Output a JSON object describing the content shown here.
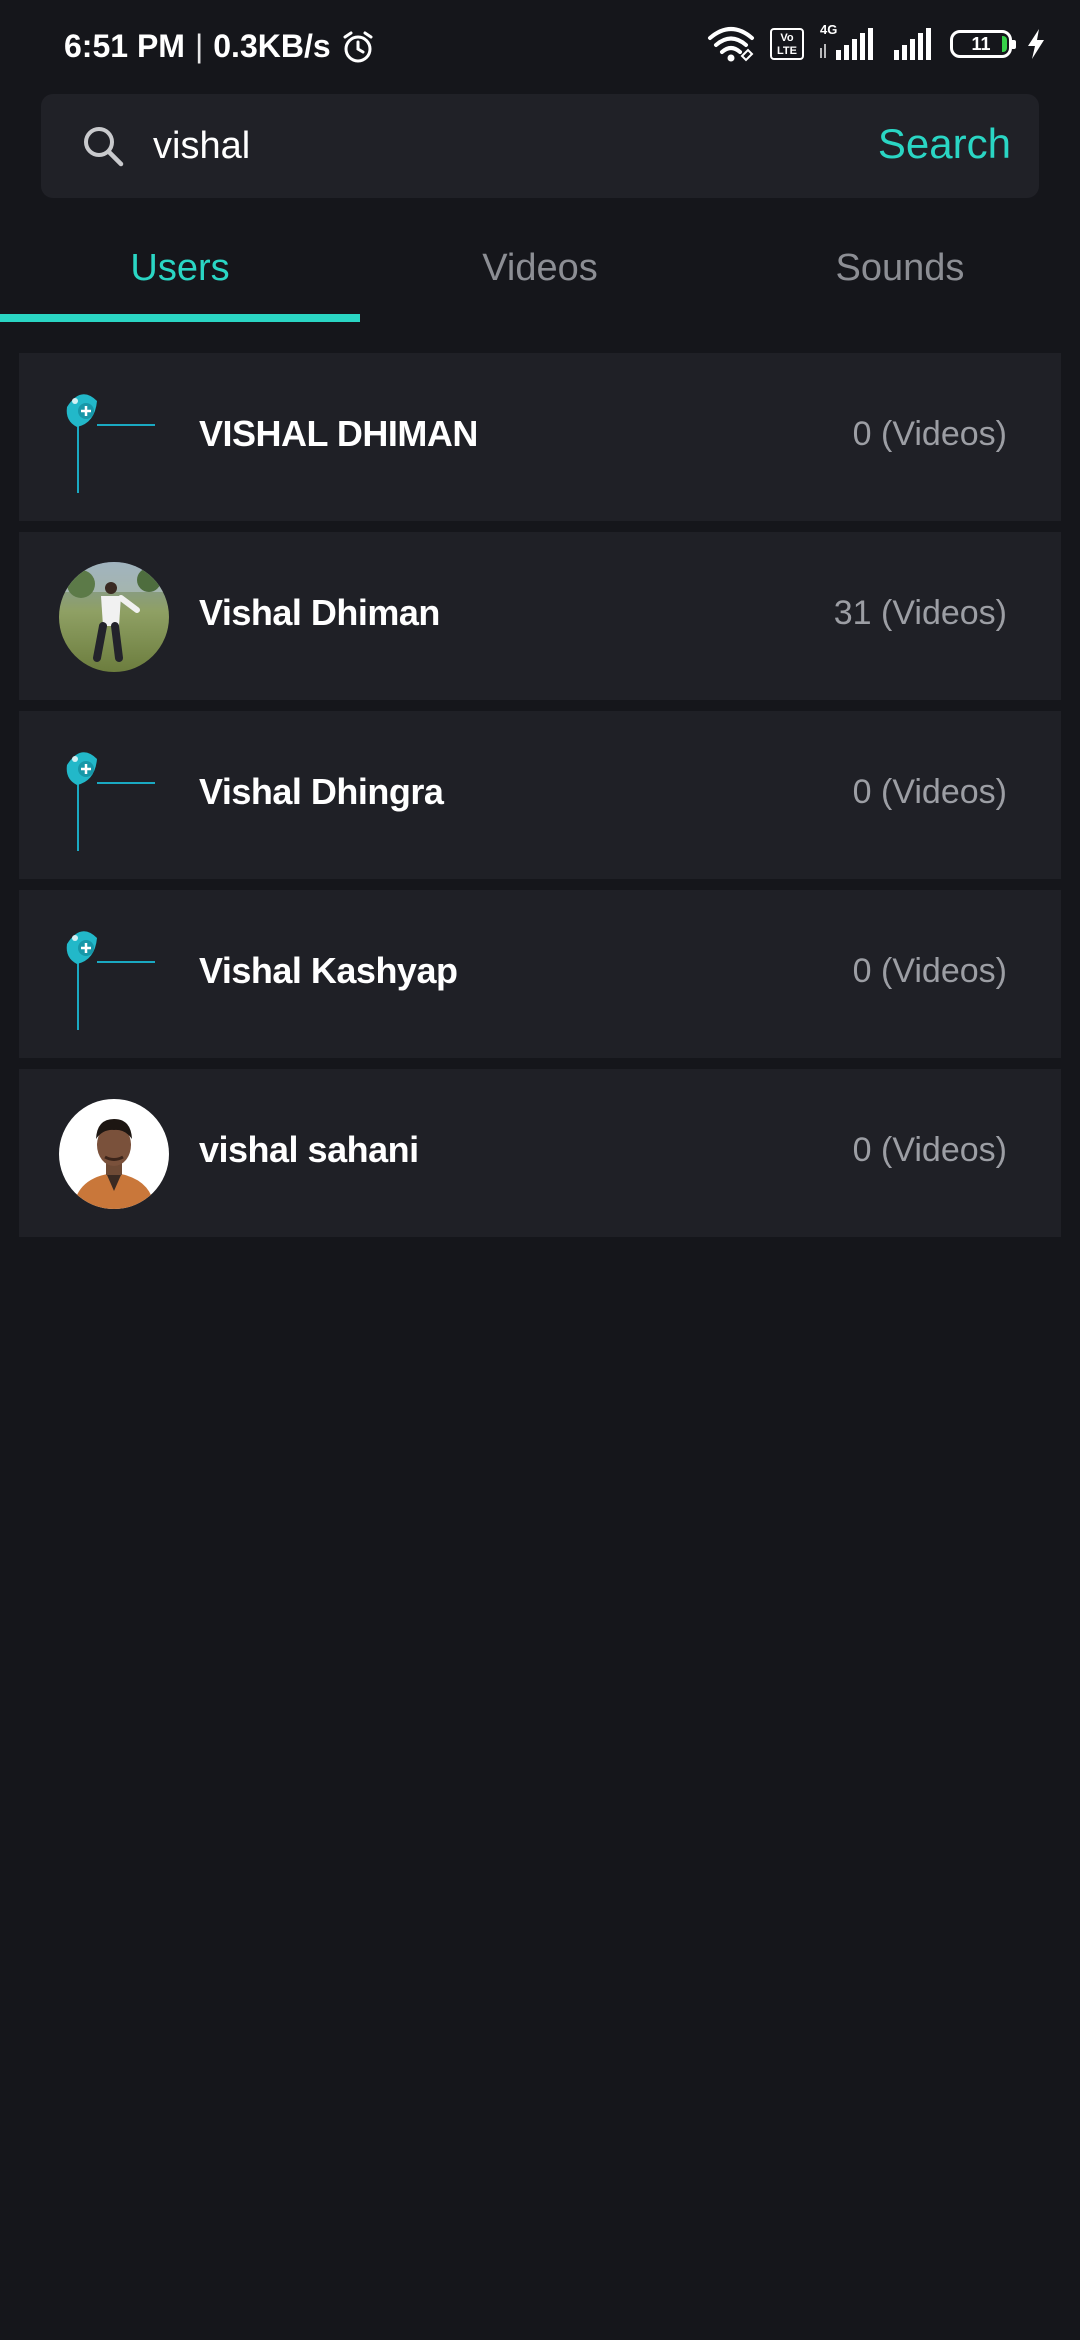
{
  "status_bar": {
    "time": "6:51 PM",
    "separator": "|",
    "network_speed": "0.3KB/s",
    "volte_label": "Vo LTE",
    "network_type": "4G",
    "battery_level": "11",
    "icons": [
      "alarm-icon",
      "wifi-icon",
      "volte-icon",
      "signal-icon",
      "signal-icon-2",
      "battery-icon",
      "charging-icon"
    ]
  },
  "search": {
    "query": "vishal",
    "button_label": "Search",
    "icon": "search-icon"
  },
  "tabs": [
    {
      "label": "Users",
      "active": true
    },
    {
      "label": "Videos",
      "active": false
    },
    {
      "label": "Sounds",
      "active": false
    }
  ],
  "users": [
    {
      "name": "VISHAL DHIMAN",
      "videos": "0 (Videos)",
      "avatar": "default-avatar"
    },
    {
      "name": "Vishal Dhiman",
      "videos": "31 (Videos)",
      "avatar": "photo-avatar"
    },
    {
      "name": "Vishal Dhingra",
      "videos": "0 (Videos)",
      "avatar": "default-avatar"
    },
    {
      "name": "Vishal Kashyap",
      "videos": "0 (Videos)",
      "avatar": "default-avatar"
    },
    {
      "name": "vishal sahani",
      "videos": "0 (Videos)",
      "avatar": "photo-avatar"
    }
  ],
  "colors": {
    "background": "#15161b",
    "surface": "#1f2026",
    "accent": "#2ad6c4",
    "muted_text": "#8c8e94"
  }
}
